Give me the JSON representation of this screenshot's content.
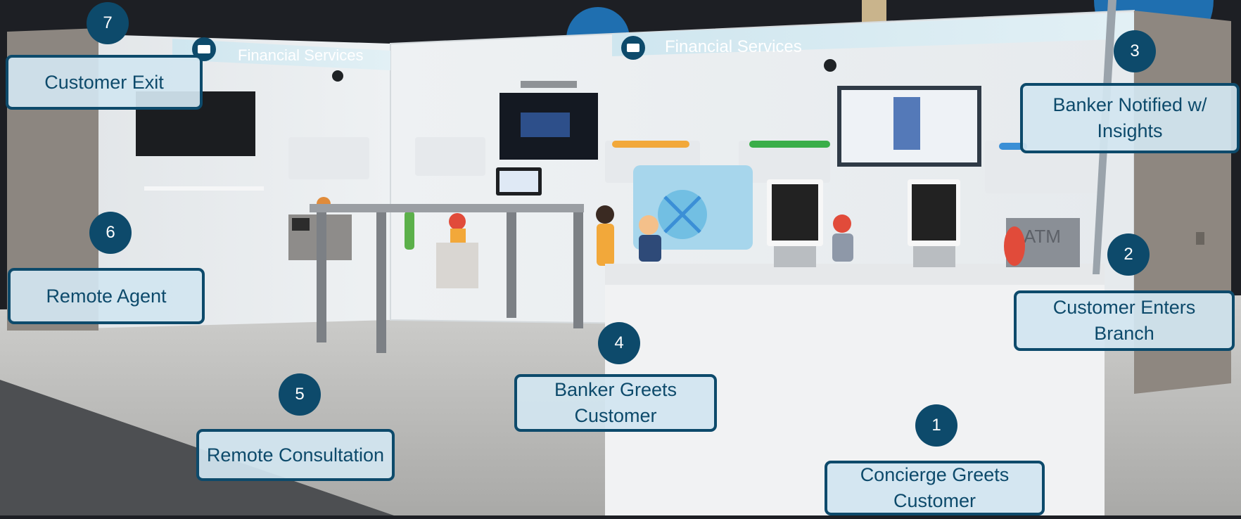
{
  "booth": {
    "sign_left": "Financial Services",
    "sign_right": "Financial Services",
    "kiosk_atm": "ATM"
  },
  "steps": [
    {
      "number": "1",
      "label": "Concierge Greets Customer"
    },
    {
      "number": "2",
      "label": "Customer Enters Branch"
    },
    {
      "number": "3",
      "label": "Banker Notified w/ Insights"
    },
    {
      "number": "4",
      "label": "Banker Greets Customer"
    },
    {
      "number": "5",
      "label": "Remote Consultation"
    },
    {
      "number": "6",
      "label": "Remote Agent"
    },
    {
      "number": "7",
      "label": "Customer Exit"
    }
  ],
  "colors": {
    "badge": "#0d4a6b",
    "callout_fill": "#d2e5f0",
    "callout_border": "#0d4a6b",
    "sign_band": "#cfe6ef"
  }
}
